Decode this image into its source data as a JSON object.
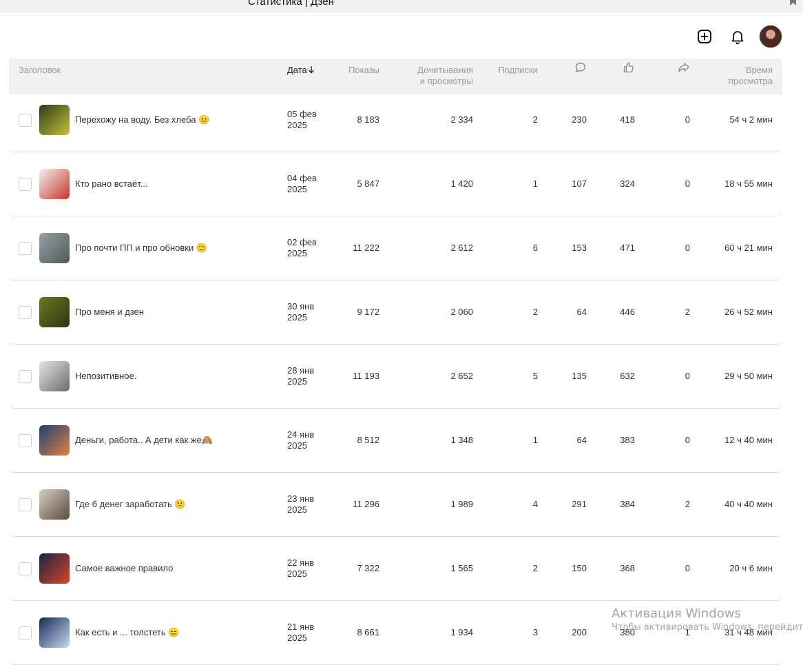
{
  "browser": {
    "tab_title": "Статистика | Дзен"
  },
  "header_icons": {
    "add": "plus-square-icon",
    "notifications": "bell-icon",
    "avatar": "user-avatar"
  },
  "columns": {
    "title": "Заголовок",
    "date": "Дата",
    "views": "Показы",
    "reads_line1": "Дочитывания",
    "reads_line2": "и просмотры",
    "subs": "Подписки",
    "comments_icon": "comment-icon",
    "likes_icon": "thumbs-up-icon",
    "shares_icon": "share-icon",
    "time_line1": "Время",
    "time_line2": "просмотра"
  },
  "rows": [
    {
      "title": "Перехожу на воду. Без хлеба 😐",
      "date1": "05 фев",
      "date2": "2025",
      "views": "8 183",
      "reads": "2 334",
      "subs": "2",
      "comments": "230",
      "likes": "418",
      "shares": "0",
      "time": "54 ч 2 мин",
      "thumb": [
        "#2d3a1a",
        "#c6c23c"
      ]
    },
    {
      "title": "Кто рано встаёт...",
      "date1": "04 фев",
      "date2": "2025",
      "views": "5 847",
      "reads": "1 420",
      "subs": "1",
      "comments": "107",
      "likes": "324",
      "shares": "0",
      "time": "18 ч 55 мин",
      "thumb": [
        "#f2f2ef",
        "#c9352d"
      ]
    },
    {
      "title": "Про почти ПП и про обновки 🙂",
      "date1": "02 фев",
      "date2": "2025",
      "views": "11 222",
      "reads": "2 612",
      "subs": "6",
      "comments": "153",
      "likes": "471",
      "shares": "0",
      "time": "60 ч 21 мин",
      "thumb": [
        "#9aa0a8",
        "#4e5a52"
      ]
    },
    {
      "title": "Про меня и дзен",
      "date1": "30 янв",
      "date2": "2025",
      "views": "9 172",
      "reads": "2 060",
      "subs": "2",
      "comments": "64",
      "likes": "446",
      "shares": "2",
      "time": "26 ч 52 мин",
      "thumb": [
        "#6b7a1e",
        "#2b3414"
      ]
    },
    {
      "title": "Непозитивное.",
      "date1": "28 янв",
      "date2": "2025",
      "views": "11 193",
      "reads": "2 652",
      "subs": "5",
      "comments": "135",
      "likes": "632",
      "shares": "0",
      "time": "29 ч 50 мин",
      "thumb": [
        "#e4e4e4",
        "#6c6c6c"
      ]
    },
    {
      "title": "Деньги, работа.. А дети как же🙈",
      "date1": "24 янв",
      "date2": "2025",
      "views": "8 512",
      "reads": "1 348",
      "subs": "1",
      "comments": "64",
      "likes": "383",
      "shares": "0",
      "time": "12 ч 40 мин",
      "thumb": [
        "#1d3f7a",
        "#e0833a"
      ]
    },
    {
      "title": "Где б денег заработать 😕",
      "date1": "23 янв",
      "date2": "2025",
      "views": "11 296",
      "reads": "1 989",
      "subs": "4",
      "comments": "291",
      "likes": "384",
      "shares": "2",
      "time": "40 ч 40 мин",
      "thumb": [
        "#d9cfc0",
        "#5a4a3c"
      ]
    },
    {
      "title": "Самое важное правило",
      "date1": "22 янв",
      "date2": "2025",
      "views": "7 322",
      "reads": "1 565",
      "subs": "2",
      "comments": "150",
      "likes": "368",
      "shares": "0",
      "time": "20 ч 6 мин",
      "thumb": [
        "#1a2340",
        "#d6452a"
      ]
    },
    {
      "title": "Как есть и ... толстеть 😑",
      "date1": "21 янв",
      "date2": "2025",
      "views": "8 661",
      "reads": "1 934",
      "subs": "3",
      "comments": "200",
      "likes": "380",
      "shares": "1",
      "time": "31 ч 48 мин",
      "thumb": [
        "#142a58",
        "#c9d8ee"
      ]
    }
  ],
  "watermark": {
    "line1": "Активация Windows",
    "line2": "Чтобы активировать Windows, перейдите"
  }
}
